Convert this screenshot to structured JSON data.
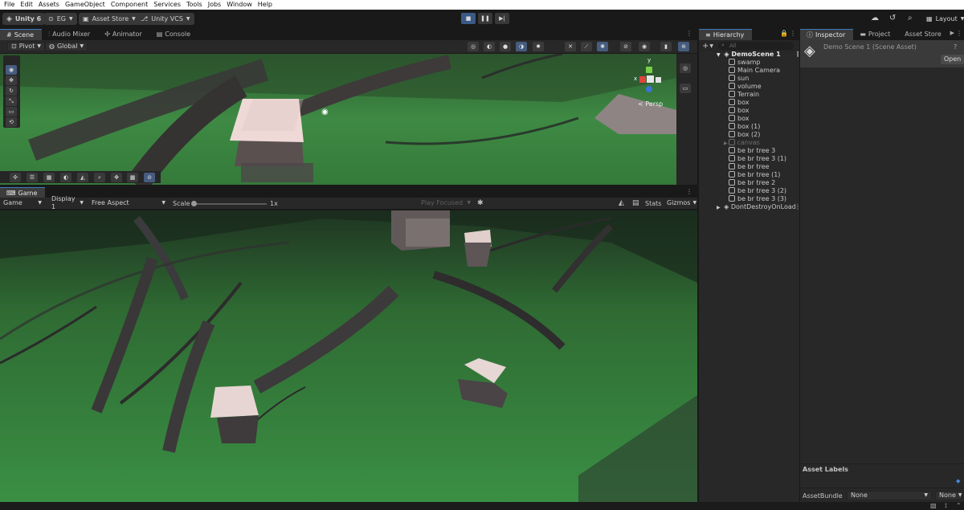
{
  "menubar": [
    "File",
    "Edit",
    "Assets",
    "GameObject",
    "Component",
    "Services",
    "Tools",
    "Jobs",
    "Window",
    "Help"
  ],
  "toolbar": {
    "unity_label": "Unity 6",
    "account_label": "EG",
    "asset_store_label": "Asset Store",
    "vcs_label": "Unity VCS",
    "layout_label": "Layout"
  },
  "scene_tabs": [
    {
      "label": "Scene",
      "icon": "grid-icon",
      "active": true
    },
    {
      "label": "Audio Mixer",
      "icon": "mixer-icon",
      "active": false
    },
    {
      "label": "Animator",
      "icon": "animator-icon",
      "active": false
    },
    {
      "label": "Console",
      "icon": "console-icon",
      "active": false
    }
  ],
  "scene_toolbar": {
    "pivot": "Pivot",
    "global": "Global",
    "persp": "< Persp",
    "gizmo_y": "y",
    "gizmo_x": "x"
  },
  "game_tab": {
    "label": "Game"
  },
  "game_toolbar": {
    "mode": "Game",
    "display": "Display 1",
    "aspect": "Free Aspect",
    "scale_label": "Scale",
    "scale_value": "1x",
    "play_focused": "Play Focused",
    "stats": "Stats",
    "gizmos": "Gizmos"
  },
  "hierarchy": {
    "tab": "Hierarchy",
    "search_placeholder": "All",
    "root": "DemoScene 1",
    "items": [
      "swamp",
      "Main Camera",
      "sun",
      "volume",
      "Terrain",
      "box",
      "box",
      "box",
      "box (1)",
      "box (2)",
      "canvas",
      "be br tree 3",
      "be br tree 3 (1)",
      "be br tree",
      "be br tree (1)",
      "be br tree 2",
      "be br tree 3 (2)",
      "be br tree 3 (3)"
    ],
    "dont_destroy": "DontDestroyOnLoad"
  },
  "inspector": {
    "tabs": [
      {
        "label": "Inspector",
        "active": true
      },
      {
        "label": "Project",
        "active": false
      },
      {
        "label": "Asset Store",
        "active": false
      }
    ],
    "asset_title": "Demo Scene 1 (Scene Asset)",
    "open_button": "Open",
    "asset_labels": "Asset Labels",
    "asset_bundle_label": "AssetBundle",
    "asset_bundle_value": "None",
    "asset_bundle_variant": "None"
  },
  "colors": {
    "accent": "#3a79bb",
    "grass": "#3f8f45",
    "panel": "#282828",
    "bg": "#191919"
  }
}
